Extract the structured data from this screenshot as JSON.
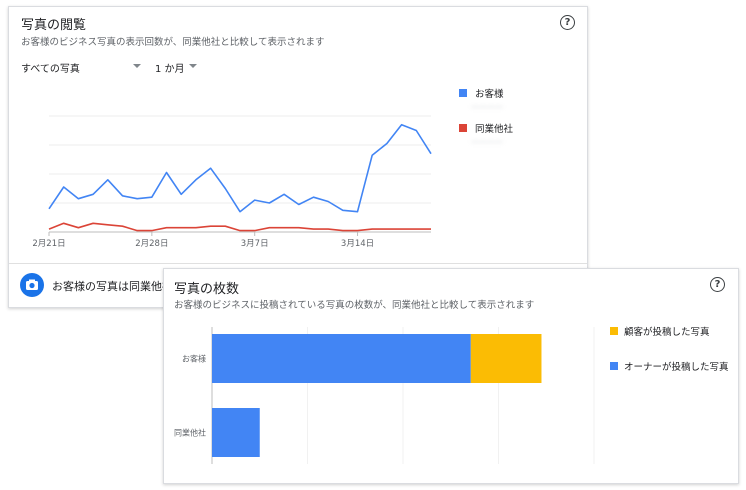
{
  "views_card": {
    "title": "写真の閲覧",
    "subtitle": "お客様のビジネス写真の表示回数が、同業他社と比較して表示されます",
    "help_label": "?",
    "filter_photos": "すべての写真",
    "filter_period": "1 か月",
    "legend": [
      {
        "label": "お客様",
        "color": "#4285f4"
      },
      {
        "label": "同業他社",
        "color": "#db4437"
      }
    ],
    "bottom_text": "お客様の写真は同業他社",
    "chart_data": {
      "type": "line",
      "x_tick_labels": [
        "2月21日",
        "2月28日",
        "3月7日",
        "3月14日"
      ],
      "x_tick_index": [
        0,
        7,
        14,
        21
      ],
      "ylim": [
        0,
        100
      ],
      "grid": true,
      "series": [
        {
          "name": "お客様",
          "color": "#4285f4",
          "values": [
            16,
            31,
            23,
            26,
            36,
            25,
            23,
            24,
            41,
            26,
            36,
            44,
            30,
            14,
            22,
            20,
            26,
            19,
            24,
            21,
            15,
            14,
            53,
            61,
            74,
            70,
            54
          ]
        },
        {
          "name": "同業他社",
          "color": "#db4437",
          "values": [
            2,
            6,
            3,
            6,
            5,
            4,
            1,
            1,
            3,
            3,
            3,
            4,
            4,
            1,
            1,
            3,
            3,
            3,
            2,
            2,
            1,
            1,
            2,
            2,
            2,
            2,
            2
          ]
        }
      ]
    }
  },
  "count_card": {
    "title": "写真の枚数",
    "subtitle": "お客様のビジネスに投稿されている写真の枚数が、同業他社と比較して表示されます",
    "help_label": "?",
    "legend": [
      {
        "label": "顧客が投稿した写真",
        "color": "#fbbc04"
      },
      {
        "label": "オーナーが投稿した写真",
        "color": "#4285f4"
      }
    ],
    "chart_data": {
      "type": "bar",
      "orientation": "horizontal",
      "stacked": true,
      "categories": [
        "お客様",
        "同業他社"
      ],
      "xlim": [
        0,
        400
      ],
      "series": [
        {
          "name": "オーナーが投稿した写真",
          "color": "#4285f4",
          "values": [
            271,
            50
          ]
        },
        {
          "name": "顧客が投稿した写真",
          "color": "#fbbc04",
          "values": [
            74,
            0
          ]
        }
      ]
    }
  }
}
